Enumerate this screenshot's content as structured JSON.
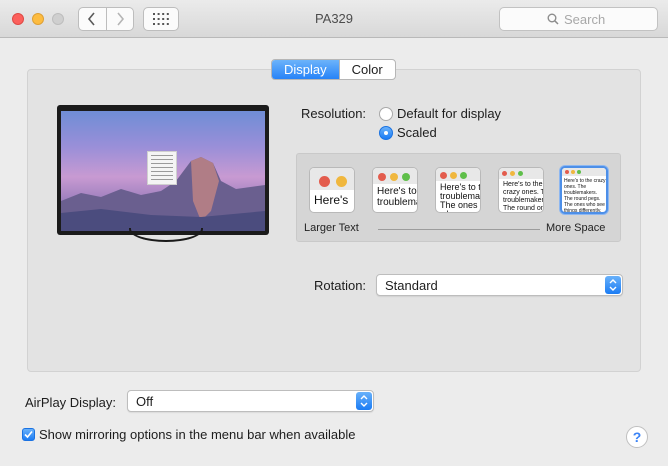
{
  "window": {
    "title": "PA329",
    "search_placeholder": "Search"
  },
  "tabs": [
    {
      "label": "Display",
      "active": true
    },
    {
      "label": "Color",
      "active": false
    }
  ],
  "resolution": {
    "label": "Resolution:",
    "options": [
      {
        "label": "Default for display",
        "selected": false
      },
      {
        "label": "Scaled",
        "selected": true
      }
    ]
  },
  "scaling": {
    "thumbnails": [
      "Here's",
      "Here's to troublemakers.",
      "Here's to the troublemakers. The ones who",
      "Here's to the crazy ones. The troublemakers. The round ones who see things",
      "Here's to the crazy ones. The troublemakers. The round pegs. The ones who see things differently. They're not fond of rules. And they have no respect for the status quo. You can quote them, disagree with them. About the only thing you can't do is ignore them. Because they change things."
    ],
    "selected_index": 4,
    "left_label": "Larger Text",
    "right_label": "More Space"
  },
  "rotation": {
    "label": "Rotation:",
    "value": "Standard"
  },
  "airplay": {
    "label": "AirPlay Display:",
    "value": "Off"
  },
  "mirroring": {
    "label": "Show mirroring options in the menu bar when available",
    "checked": true
  },
  "help_label": "?",
  "colors": {
    "accent": "#2783f8",
    "window_bg": "#ececec",
    "panel_bg": "#e3e3e3"
  }
}
